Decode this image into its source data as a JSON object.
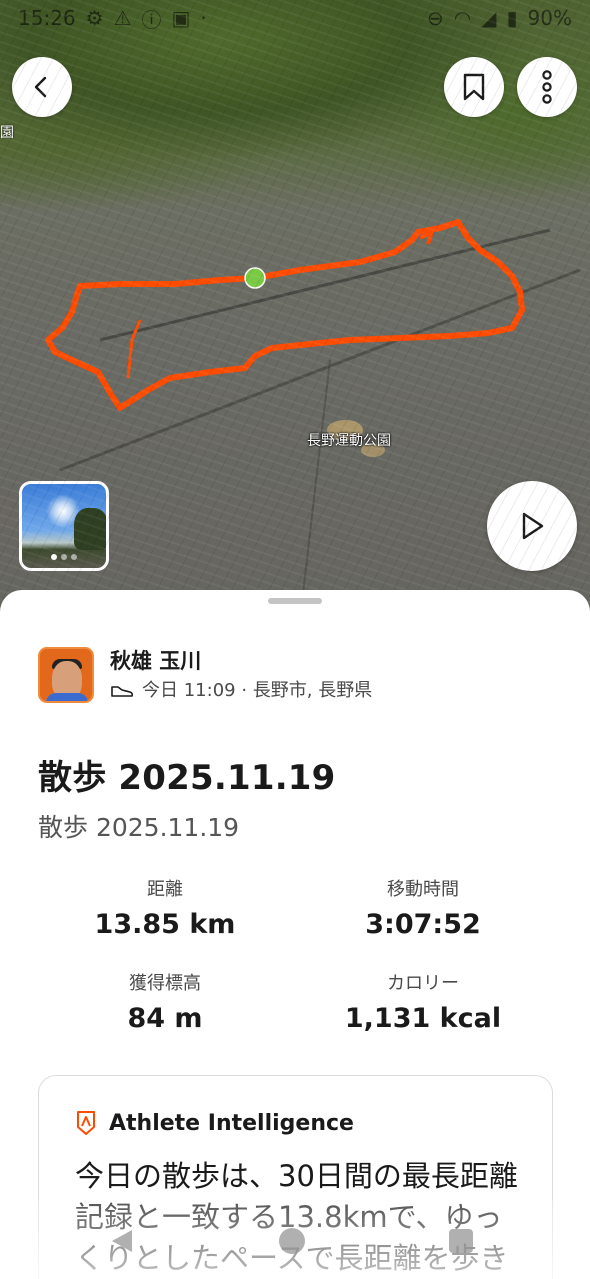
{
  "status_bar": {
    "time": "15:26",
    "battery": "90%",
    "left_icons": [
      "settings-icon",
      "warning-icon",
      "info-icon",
      "gallery-icon",
      "dot-icon"
    ],
    "right_icons": [
      "alarm-icon",
      "wifi-icon",
      "signal-icon",
      "battery-icon"
    ]
  },
  "map": {
    "park_label": "長野運動公園",
    "edge_label": "園",
    "route_color": "#fc4c02",
    "start_marker_color": "#7ac943",
    "photo_count_dots": 3
  },
  "toolbar": {
    "back_icon": "chevron-left-icon",
    "bookmark_icon": "bookmark-icon",
    "more_icon": "more-vertical-icon",
    "play_icon": "play-icon"
  },
  "athlete": {
    "name": "秋雄 玉川",
    "meta": "今日 11:09 · 長野市, 長野県",
    "activity_icon": "shoe-icon"
  },
  "activity": {
    "title": "散歩 2025.11.19",
    "description": "散歩 2025.11.19"
  },
  "stats": [
    {
      "label": "距離",
      "value": "13.85 km"
    },
    {
      "label": "移動時間",
      "value": "3:07:52"
    },
    {
      "label": "獲得標高",
      "value": "84 m"
    },
    {
      "label": "カロリー",
      "value": "1,131 kcal"
    }
  ],
  "athlete_intelligence": {
    "title": "Athlete Intelligence",
    "text": "今日の散歩は、30日間の最長距離記録と一致する13.8kmで、ゆっくりとしたペースで長距離を歩きました。",
    "accent": "#fc4c02"
  },
  "nav": {
    "back_icon": "nav-back-icon",
    "home_icon": "nav-home-icon",
    "recent_icon": "nav-recent-icon"
  }
}
